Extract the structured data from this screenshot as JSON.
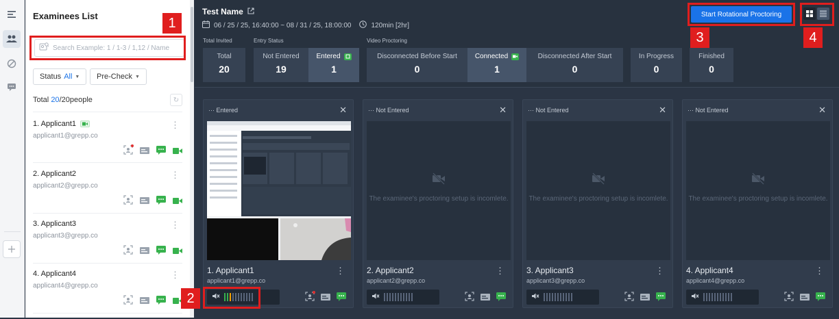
{
  "rail": {
    "icons": [
      "sidebar-toggle-icon",
      "people-icon",
      "block-icon",
      "chat-icon",
      "plus-icon"
    ]
  },
  "sidebar": {
    "title": "Examinees List",
    "search_placeholder": "Search Example: 1 / 1-3 / 1,12 / Name",
    "status_filter_label": "Status",
    "status_filter_value": "All",
    "precheck_label": "Pre-Check",
    "total_label": "Total",
    "total_shown": "20",
    "total_sep": "/",
    "total_count": "20",
    "total_unit": "people",
    "examinees": [
      {
        "name": "1. Applicant1",
        "email": "applicant1@grepp.co"
      },
      {
        "name": "2. Applicant2",
        "email": "applicant2@grepp.co"
      },
      {
        "name": "3. Applicant3",
        "email": "applicant3@grepp.co"
      },
      {
        "name": "4. Applicant4",
        "email": "applicant4@grepp.co"
      }
    ]
  },
  "header": {
    "test_name": "Test Name",
    "date_range": "06 / 25 / 25, 16:40:00 ~ 08 / 31 / 25, 18:00:00",
    "duration": "120min [2hr]",
    "start_button": "Start Rotational Proctoring"
  },
  "stats": {
    "groups": {
      "total_invited": "Total Invited",
      "entry_status": "Entry Status",
      "video_proctoring": "Video Proctoring"
    },
    "total": {
      "label": "Total",
      "value": "20"
    },
    "not_entered": {
      "label": "Not Entered",
      "value": "19"
    },
    "entered": {
      "label": "Entered",
      "value": "1"
    },
    "disconnected_before": {
      "label": "Disconnected Before Start",
      "value": "0"
    },
    "connected": {
      "label": "Connected",
      "value": "1"
    },
    "disconnected_after": {
      "label": "Disconnected After Start",
      "value": "0"
    },
    "in_progress": {
      "label": "In Progress",
      "value": "0"
    },
    "finished": {
      "label": "Finished",
      "value": "0"
    }
  },
  "cards": [
    {
      "status": "··· Entered",
      "name": "1. Applicant1",
      "email": "applicant1@grepp.co"
    },
    {
      "status": "··· Not Entered",
      "name": "2. Applicant2",
      "email": "applicant2@grepp.co",
      "nocam_text": "The examinee's proctoring setup is incomlete."
    },
    {
      "status": "··· Not Entered",
      "name": "3. Applicant3",
      "email": "applicant3@grepp.co",
      "nocam_text": "The examinee's proctoring setup is incomlete."
    },
    {
      "status": "··· Not Entered",
      "name": "4. Applicant4",
      "email": "applicant4@grepp.co",
      "nocam_text": "The examinee's proctoring setup is incomlete."
    }
  ],
  "annotations": [
    "1",
    "2",
    "3",
    "4"
  ],
  "colors": {
    "accent": "#1a73e8",
    "green": "#37b24d",
    "annotation": "#e01e1e",
    "panel": "#2b3544"
  }
}
